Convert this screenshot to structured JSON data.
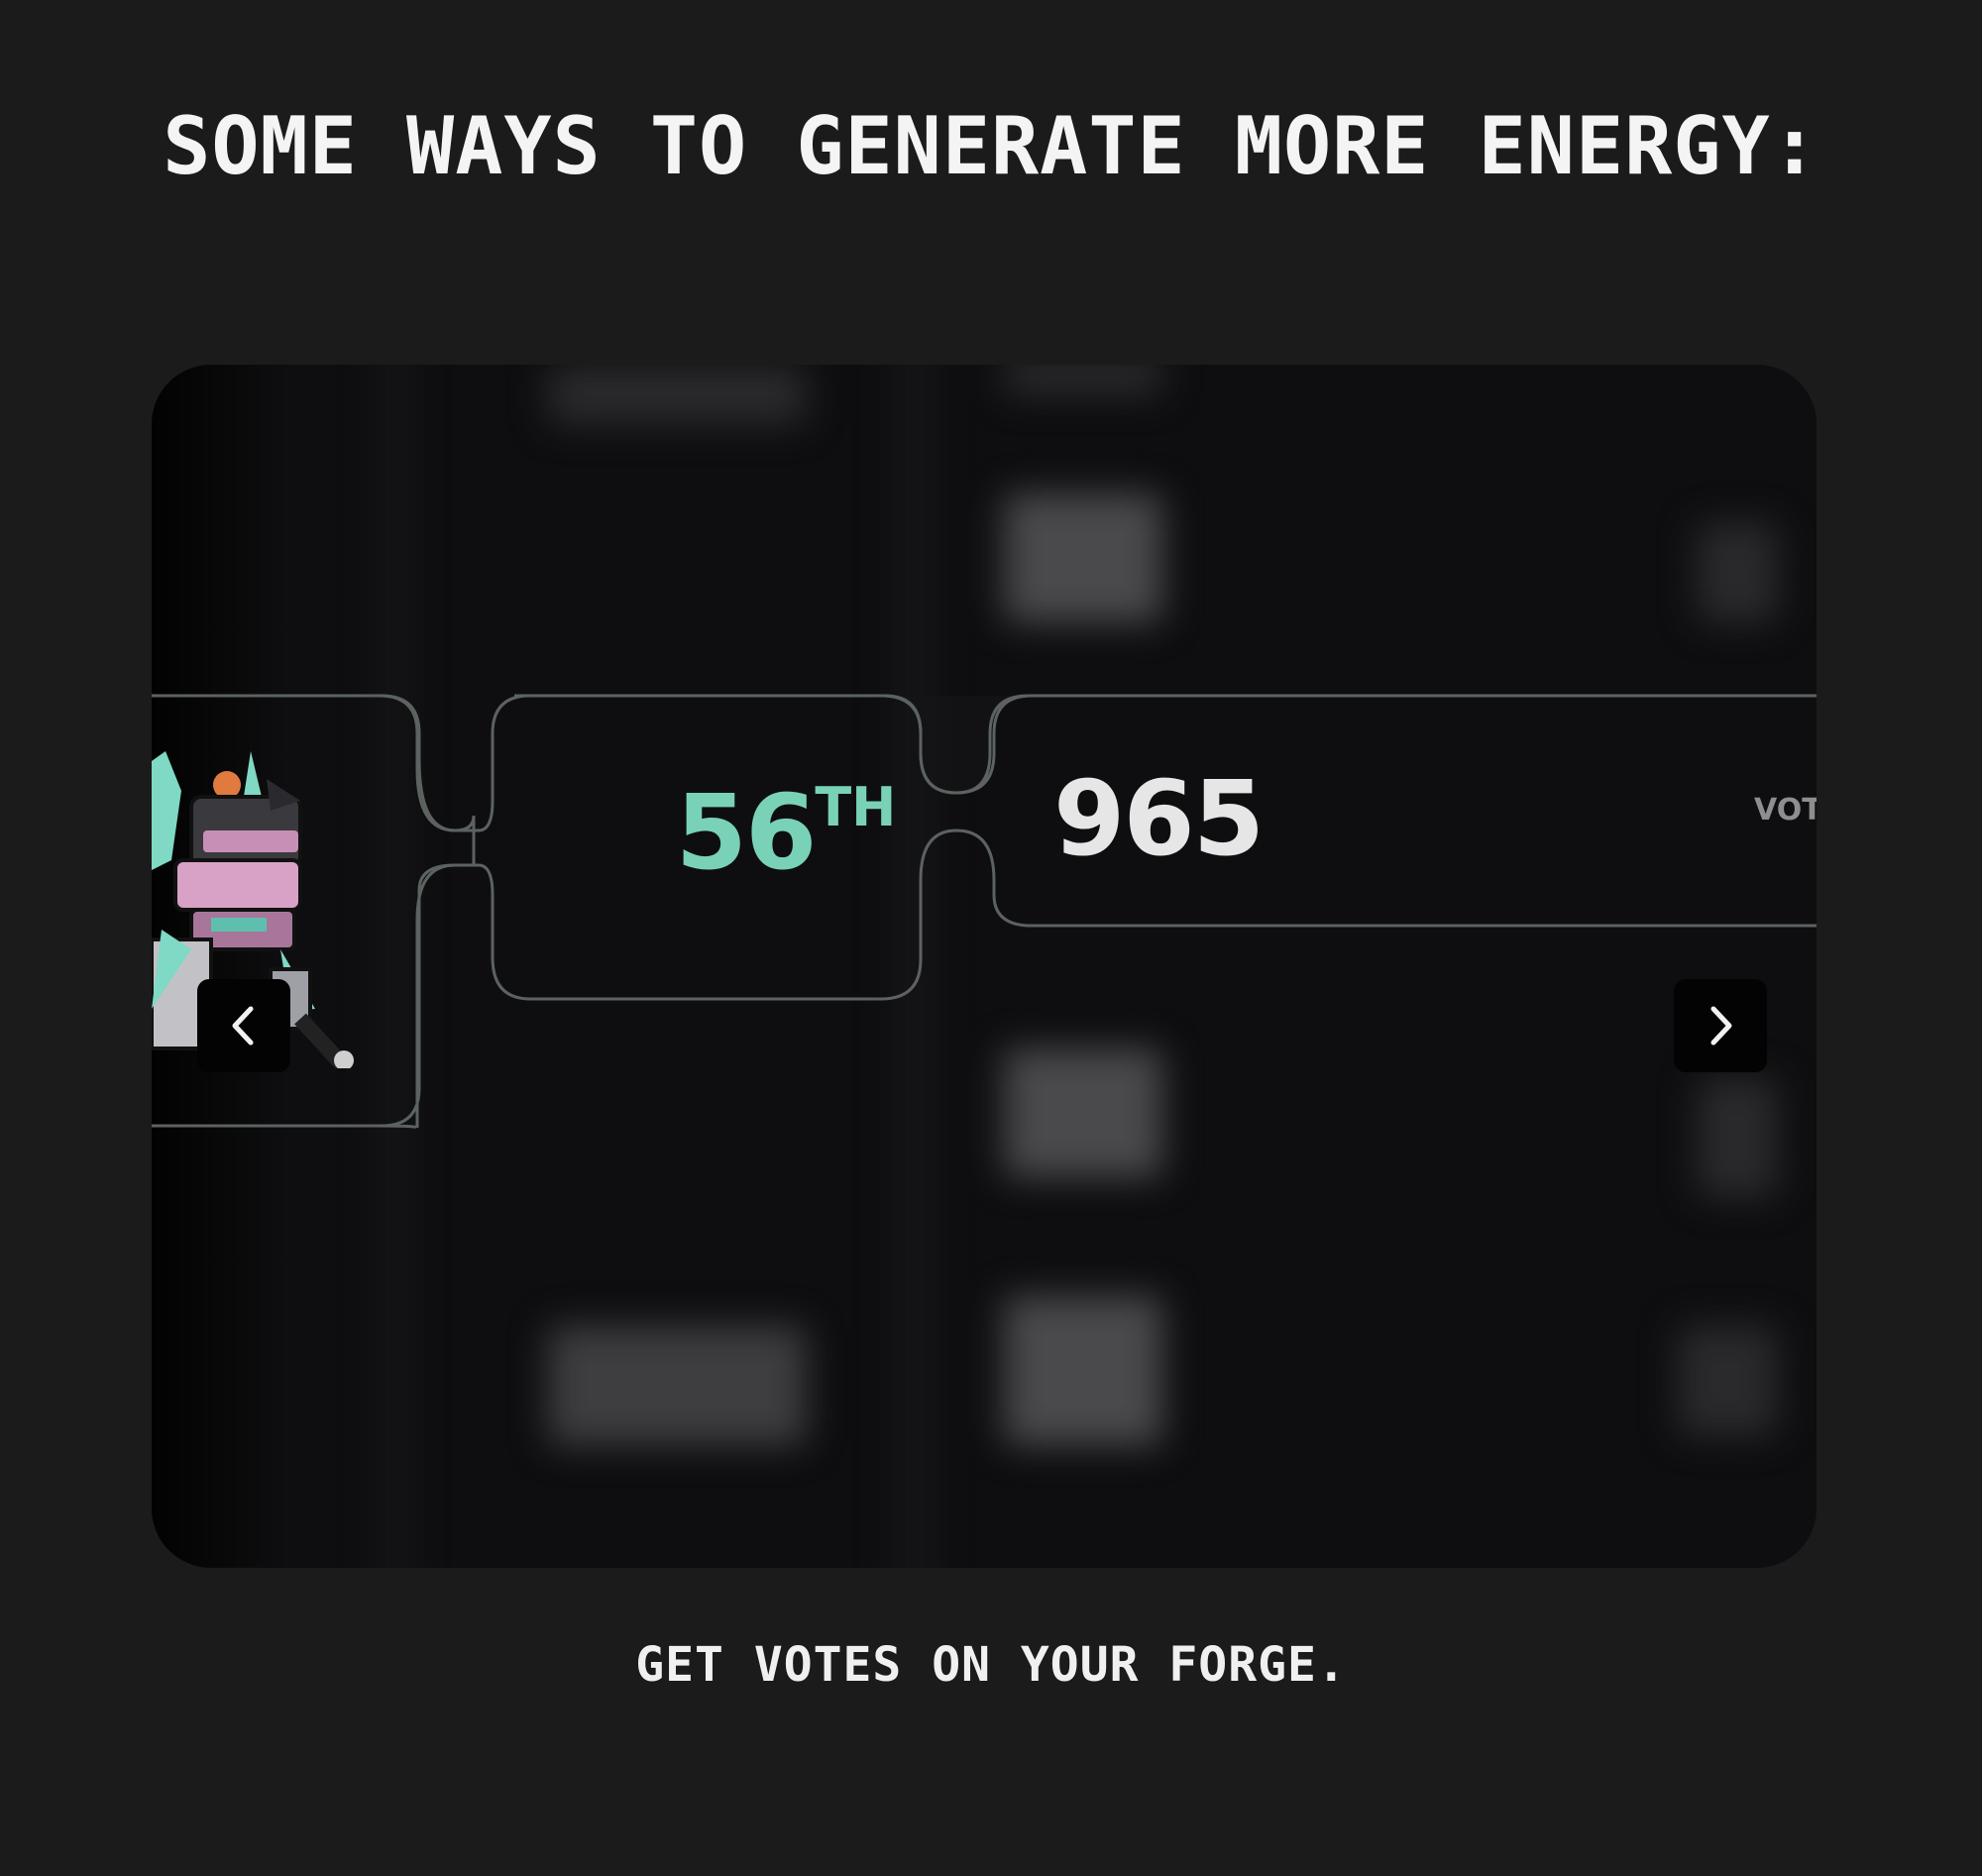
{
  "heading": "SOME WAYS TO GENERATE MORE ENERGY:",
  "slide": {
    "rank_number": "56",
    "rank_suffix": "TH",
    "votes_count": "965",
    "votes_label": "VOTES",
    "avatar_icon": "robot-avatar-icon"
  },
  "carousel": {
    "prev_icon": "chevron-left-icon",
    "next_icon": "chevron-right-icon"
  },
  "caption": "GET VOTES ON YOUR FORGE.",
  "colors": {
    "background": "#1b1b1c",
    "rank_accent": "#79d2b8",
    "panel_border": "#5c6260"
  }
}
